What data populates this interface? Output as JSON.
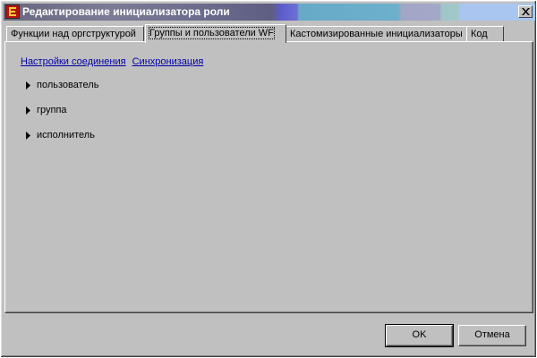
{
  "window": {
    "title": "Редактирование инициализатора роли",
    "logo_letter": "E"
  },
  "tabs": [
    {
      "label": "Функции над оргструктурой",
      "active": false
    },
    {
      "label": "Группы и пользователи WF",
      "active": true
    },
    {
      "label": "Кастомизированные инициализаторы",
      "active": false
    },
    {
      "label": "Код",
      "active": false
    }
  ],
  "links": {
    "connection_settings": "Настройки соединения",
    "sync": "Синхронизация"
  },
  "tree": [
    {
      "label": "пользователь"
    },
    {
      "label": "группа"
    },
    {
      "label": "исполнитель"
    }
  ],
  "buttons": {
    "ok": "OK",
    "cancel": "Отмена"
  },
  "colors": {
    "face": "#c0c0c0",
    "link": "#0000a8",
    "logo_bg": "#b5140c",
    "logo_fg": "#f6cf3a"
  },
  "icons": {
    "logo": "app-logo-icon",
    "close": "close-icon",
    "expand": "triangle-right-icon"
  }
}
